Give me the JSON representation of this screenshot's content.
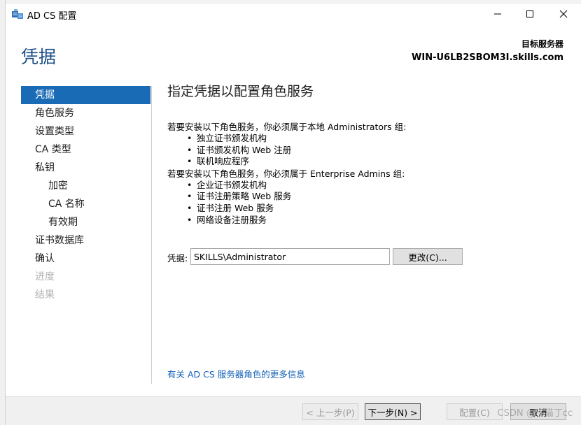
{
  "window": {
    "title": "AD CS 配置",
    "minimize_icon": "minimize-icon",
    "maximize_icon": "maximize-icon",
    "close_icon": "close-icon"
  },
  "header": {
    "title": "凭据",
    "target_label": "目标服务器",
    "target_name": "WIN-U6LB2SBOM3I.skills.com"
  },
  "nav": {
    "items": [
      {
        "label": "凭据",
        "state": "selected"
      },
      {
        "label": "角色服务",
        "state": "normal"
      },
      {
        "label": "设置类型",
        "state": "normal"
      },
      {
        "label": "CA 类型",
        "state": "normal"
      },
      {
        "label": "私钥",
        "state": "normal"
      },
      {
        "label": "加密",
        "state": "sub"
      },
      {
        "label": "CA 名称",
        "state": "sub"
      },
      {
        "label": "有效期",
        "state": "sub"
      },
      {
        "label": "证书数据库",
        "state": "normal"
      },
      {
        "label": "确认",
        "state": "normal"
      },
      {
        "label": "进度",
        "state": "disabled"
      },
      {
        "label": "结果",
        "state": "disabled"
      }
    ]
  },
  "content": {
    "title": "指定凭据以配置角色服务",
    "para1": "若要安装以下角色服务，你必须属于本地 Administrators 组:",
    "list1": [
      "独立证书颁发机构",
      "证书颁发机构 Web 注册",
      "联机响应程序"
    ],
    "para2": "若要安装以下角色服务，你必须属于 Enterprise Admins 组:",
    "list2": [
      "企业证书颁发机构",
      "证书注册策略 Web 服务",
      "证书注册 Web 服务",
      "网络设备注册服务"
    ],
    "credential_label": "凭据:",
    "credential_value": "SKILLS\\Administrator",
    "change_button": "更改(C)...",
    "more_info_link": "有关 AD CS 服务器角色的更多信息"
  },
  "footer": {
    "back_button": "< 上一步(P)",
    "next_button": "下一步(N) >",
    "configure_button": "配置(C)",
    "cancel_button": "取消"
  },
  "watermark": "CSDN @小猫丁cc",
  "colors": {
    "accent": "#1a6bb6",
    "header_title": "#1c4e88",
    "link": "#1060b8"
  }
}
